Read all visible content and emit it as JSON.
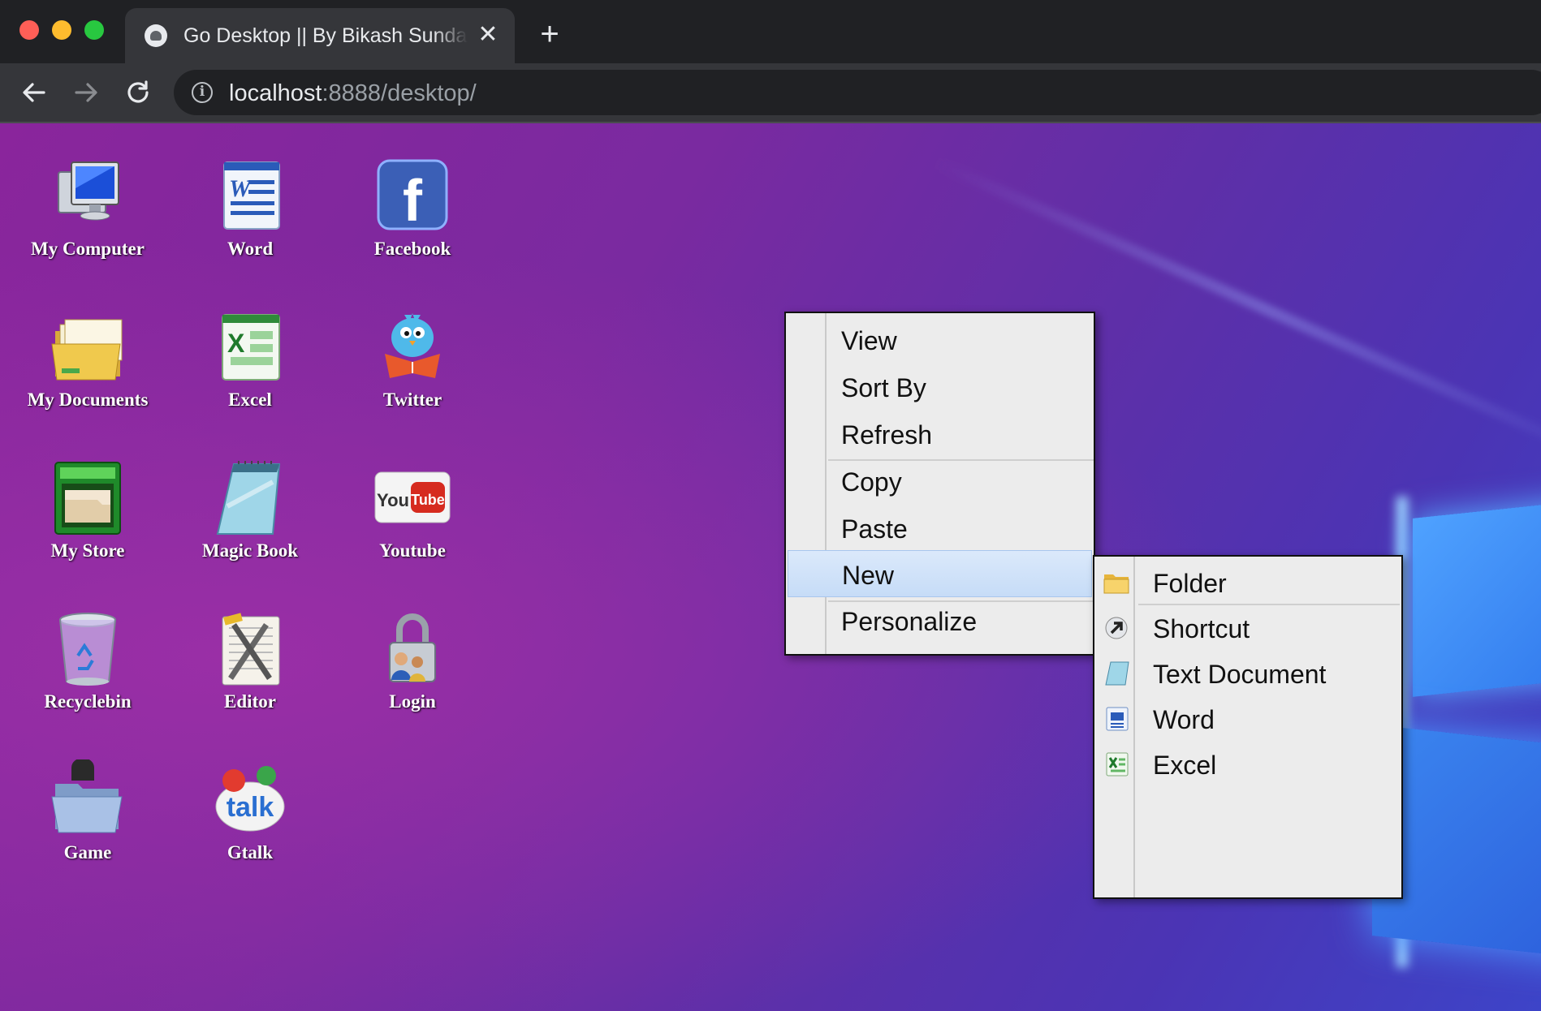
{
  "browser": {
    "tab_title": "Go Desktop || By Bikash Sundar",
    "tab_close": "✕",
    "new_tab": "+",
    "url_host": "localhost",
    "url_rest": ":8888/desktop/",
    "info_icon": "i"
  },
  "desktop": {
    "icons": [
      {
        "label": "My Computer",
        "icon": "computer-icon"
      },
      {
        "label": "Word",
        "icon": "word-icon"
      },
      {
        "label": "Facebook",
        "icon": "facebook-icon"
      },
      {
        "label": "My Documents",
        "icon": "folders-icon"
      },
      {
        "label": "Excel",
        "icon": "excel-icon"
      },
      {
        "label": "Twitter",
        "icon": "twitter-bird-icon"
      },
      {
        "label": "My Store",
        "icon": "store-icon"
      },
      {
        "label": "Magic Book",
        "icon": "notepad-icon"
      },
      {
        "label": "Youtube",
        "icon": "youtube-icon"
      },
      {
        "label": "Recyclebin",
        "icon": "recycle-bin-icon"
      },
      {
        "label": "Editor",
        "icon": "editor-tools-icon"
      },
      {
        "label": "Login",
        "icon": "padlock-users-icon"
      },
      {
        "label": "Game",
        "icon": "game-folder-icon"
      },
      {
        "label": "Gtalk",
        "icon": "gtalk-icon"
      }
    ],
    "icon_text": {
      "word": "W",
      "facebook": "f",
      "excel": "X",
      "youtube_you": "You",
      "youtube_tube": "Tube",
      "gtalk": "talk"
    }
  },
  "context_menu": {
    "items": [
      "View",
      "Sort By",
      "Refresh",
      "Copy",
      "Paste",
      "New",
      "Personalize"
    ],
    "highlighted": "New"
  },
  "submenu_new": {
    "items": [
      {
        "label": "Folder",
        "icon": "folder-icon"
      },
      {
        "label": "Shortcut",
        "icon": "shortcut-icon"
      },
      {
        "label": "Text Document",
        "icon": "text-document-icon"
      },
      {
        "label": "Word",
        "icon": "word-doc-icon"
      },
      {
        "label": "Excel",
        "icon": "excel-doc-icon"
      }
    ]
  },
  "colors": {
    "menu_bg": "#ececec",
    "highlight": "#c6dcf7",
    "desktop_purple": "#7a2aa0"
  }
}
